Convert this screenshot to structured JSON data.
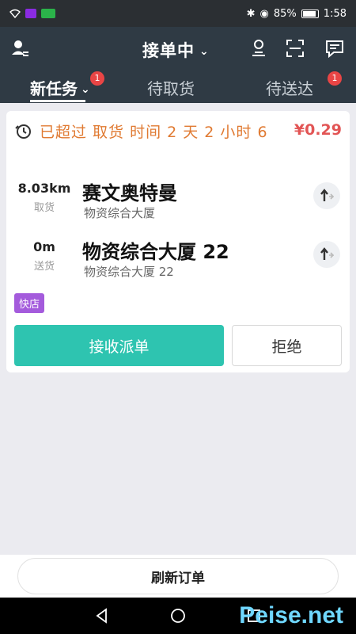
{
  "status_bar": {
    "battery": "85%",
    "time": "1:58"
  },
  "header": {
    "title": "接单中"
  },
  "tabs": [
    {
      "label": "新任务",
      "badge": "1"
    },
    {
      "label": "待取货"
    },
    {
      "label": "待送达",
      "badge": "1"
    }
  ],
  "order": {
    "overdue_text": "已超过 取货 时间 2 天 2 小时 6",
    "price": "¥0.29",
    "pickup": {
      "distance": "8.03km",
      "label": "取货",
      "name": "赛文奥特曼",
      "address": "物资综合大厦"
    },
    "dropoff": {
      "distance": "0m",
      "label": "送货",
      "name": "物资综合大厦 22",
      "address": "物资综合大厦 22"
    },
    "tag": "快店",
    "accept_label": "接收派单",
    "reject_label": "拒绝"
  },
  "refresh_label": "刷新订单",
  "watermark": "Peise.net",
  "colors": {
    "header": "#2f3a44",
    "accent": "#2ec4b0",
    "badge": "#e94545",
    "overdue": "#e07a32",
    "price": "#e25555",
    "tag": "#a45bdc"
  }
}
